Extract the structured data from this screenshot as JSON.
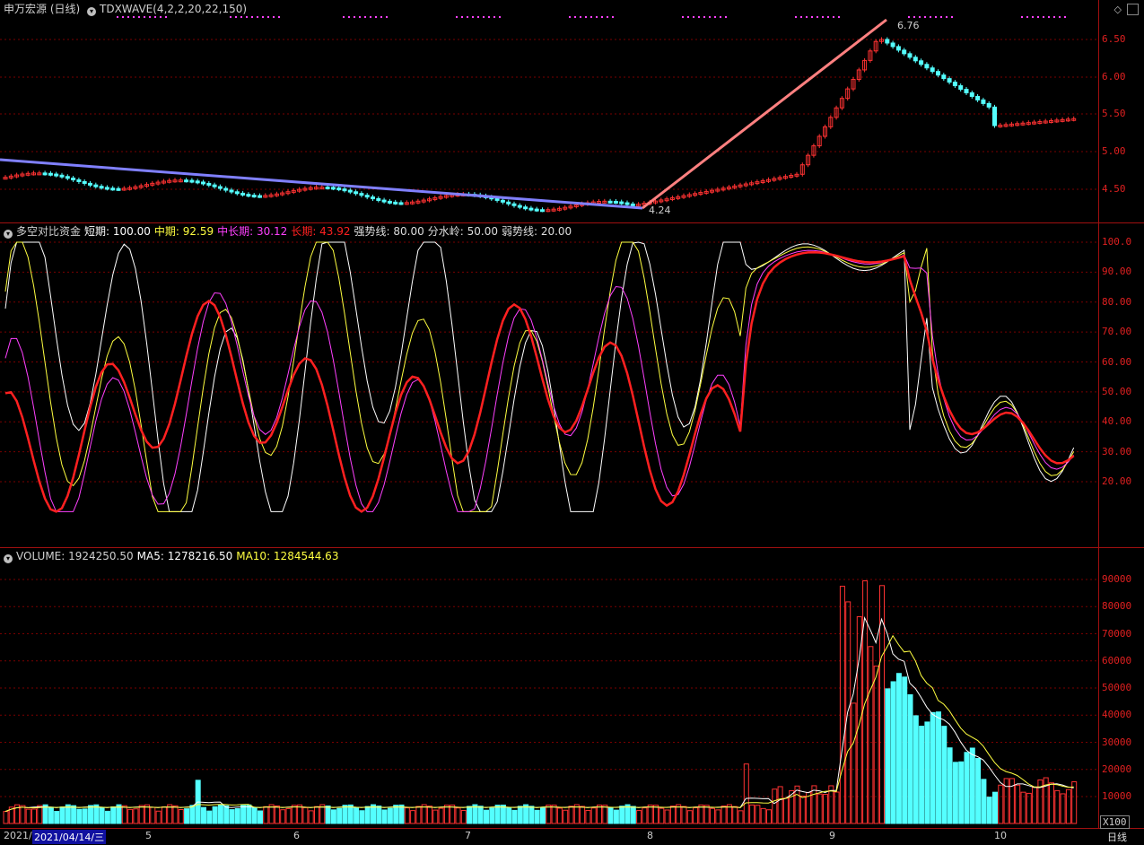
{
  "colors": {
    "up": "#ff3232",
    "down": "#54ffff",
    "grid": "#7a0000",
    "axis": "#e02020",
    "wave_down": "#8080ff",
    "wave_up": "#ff8080",
    "short": "#ffffff",
    "mid": "#ffff40",
    "midlong": "#ff40ff",
    "long": "#ff2020",
    "vol_up": "#ff3232",
    "vol_down": "#54ffff"
  },
  "header": {
    "stock": "申万宏源 (日线)",
    "indicator": "TDXWAVE(4,2,2,20,22,150)",
    "peak_label": "6.76",
    "trough_label": "4.24"
  },
  "price_axis": [
    "6.50",
    "6.00",
    "5.50",
    "5.00",
    "4.50"
  ],
  "osc_header": {
    "name": "多空对比资金",
    "short": "短期: 100.00",
    "mid": "中期: 92.59",
    "midlong": "中长期: 30.12",
    "long": "长期: 43.92",
    "strong": "强势线: 80.00",
    "water": "分水岭: 50.00",
    "weak": "弱势线: 20.00"
  },
  "osc_axis": [
    "100.0",
    "90.00",
    "80.00",
    "70.00",
    "60.00",
    "50.00",
    "40.00",
    "30.00",
    "20.00"
  ],
  "vol_header": {
    "name": "VOLUME: 1924250.50",
    "ma5": "MA5: 1278216.50",
    "ma10": "MA10: 1284544.63"
  },
  "vol_axis": [
    "90000",
    "80000",
    "70000",
    "60000",
    "50000",
    "40000",
    "30000",
    "20000",
    "10000"
  ],
  "vol_unit": "X100",
  "dates": {
    "start": "2021/",
    "cursor": "2021/04/14/三",
    "m5": "5",
    "m6": "6",
    "m7": "7",
    "m8": "8",
    "m9": "9",
    "m10": "10",
    "period": "日线"
  },
  "chart_data": {
    "type": "candlestick",
    "price_range": [
      4.2,
      6.9
    ],
    "wave_points": [
      {
        "label": "4.24",
        "value": 4.24
      },
      {
        "label": "6.76",
        "value": 6.76
      }
    ],
    "oscillator_levels": [
      80,
      50,
      20
    ],
    "volume_range": [
      0,
      100000
    ]
  }
}
